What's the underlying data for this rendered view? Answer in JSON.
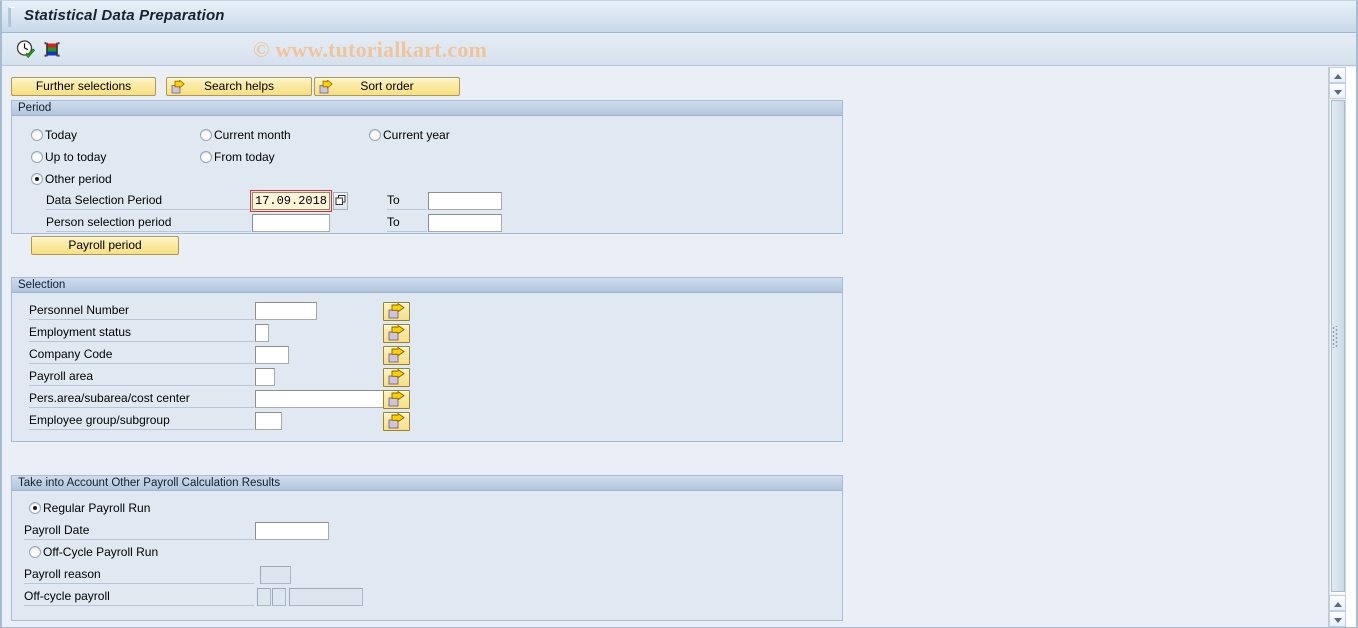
{
  "window": {
    "title": "Statistical Data Preparation",
    "watermark": "© www.tutorialkart.com"
  },
  "toolbar": {
    "buttons": [
      {
        "name": "execute-button",
        "icon": "clock-check-icon",
        "tooltip": "Execute"
      },
      {
        "name": "execute-print-button",
        "icon": "color-bars-icon",
        "tooltip": "Execute + Print"
      }
    ]
  },
  "action_buttons": [
    {
      "label": "Further selections",
      "icon": null
    },
    {
      "label": "Search helps",
      "icon": "yellow-arrow-icon"
    },
    {
      "label": "Sort order",
      "icon": "yellow-arrow-icon"
    }
  ],
  "period": {
    "title": "Period",
    "radios": [
      {
        "label": "Today",
        "selected": false
      },
      {
        "label": "Current month",
        "selected": false
      },
      {
        "label": "Current year",
        "selected": false
      },
      {
        "label": "Up to today",
        "selected": false
      },
      {
        "label": "From today",
        "selected": false
      },
      {
        "label": "Other period",
        "selected": true
      }
    ],
    "rows": [
      {
        "label": "Data Selection Period",
        "value": "17.09.2018",
        "focused": true,
        "has_matchcode": true,
        "to_label": "To",
        "to_value": ""
      },
      {
        "label": "Person selection period",
        "value": "",
        "focused": false,
        "has_matchcode": false,
        "to_label": "To",
        "to_value": ""
      }
    ],
    "payroll_period_button": "Payroll period"
  },
  "selection": {
    "title": "Selection",
    "rows": [
      {
        "label": "Personnel Number",
        "value": "",
        "field_width": 62,
        "multi_icon": "yellow-arrow-icon"
      },
      {
        "label": "Employment status",
        "value": "",
        "field_width": 14,
        "multi_icon": "yellow-arrow-icon"
      },
      {
        "label": "Company Code",
        "value": "",
        "field_width": 34,
        "multi_icon": "yellow-arrow-icon"
      },
      {
        "label": "Payroll area",
        "value": "",
        "field_width": 20,
        "multi_icon": "yellow-arrow-icon"
      },
      {
        "label": "Pers.area/subarea/cost center",
        "value": "",
        "field_width": 132,
        "multi_icon": "yellow-arrow-icon"
      },
      {
        "label": "Employee group/subgroup",
        "value": "",
        "field_width": 27,
        "multi_icon": "yellow-arrow-icon"
      }
    ]
  },
  "payroll_results": {
    "title": "Take into Account Other Payroll Calculation Results",
    "regular_radio": {
      "label": "Regular Payroll Run",
      "selected": true
    },
    "payroll_date": {
      "label": "Payroll Date",
      "value": "",
      "disabled": false
    },
    "offcycle_radio": {
      "label": "Off-Cycle Payroll Run",
      "selected": false
    },
    "payroll_reason": {
      "label": "Payroll reason",
      "value": "",
      "disabled": true
    },
    "offcycle_payroll": {
      "label": "Off-cycle payroll",
      "values": [
        "",
        "",
        ""
      ],
      "disabled": true
    }
  },
  "scrollbars": {
    "top": {
      "up": "scroll-up-icon",
      "down": "scroll-down-icon"
    },
    "bottom": {
      "up": "scroll-up-icon",
      "down": "scroll-down-icon"
    }
  },
  "colors": {
    "accent_button": "#fae99f",
    "panel_bg": "#e0e9f2",
    "panel_border": "#a5bdd6",
    "window_bg": "#eaeff5",
    "focus_outline": "#e03030",
    "watermark": "#f0c49a"
  }
}
